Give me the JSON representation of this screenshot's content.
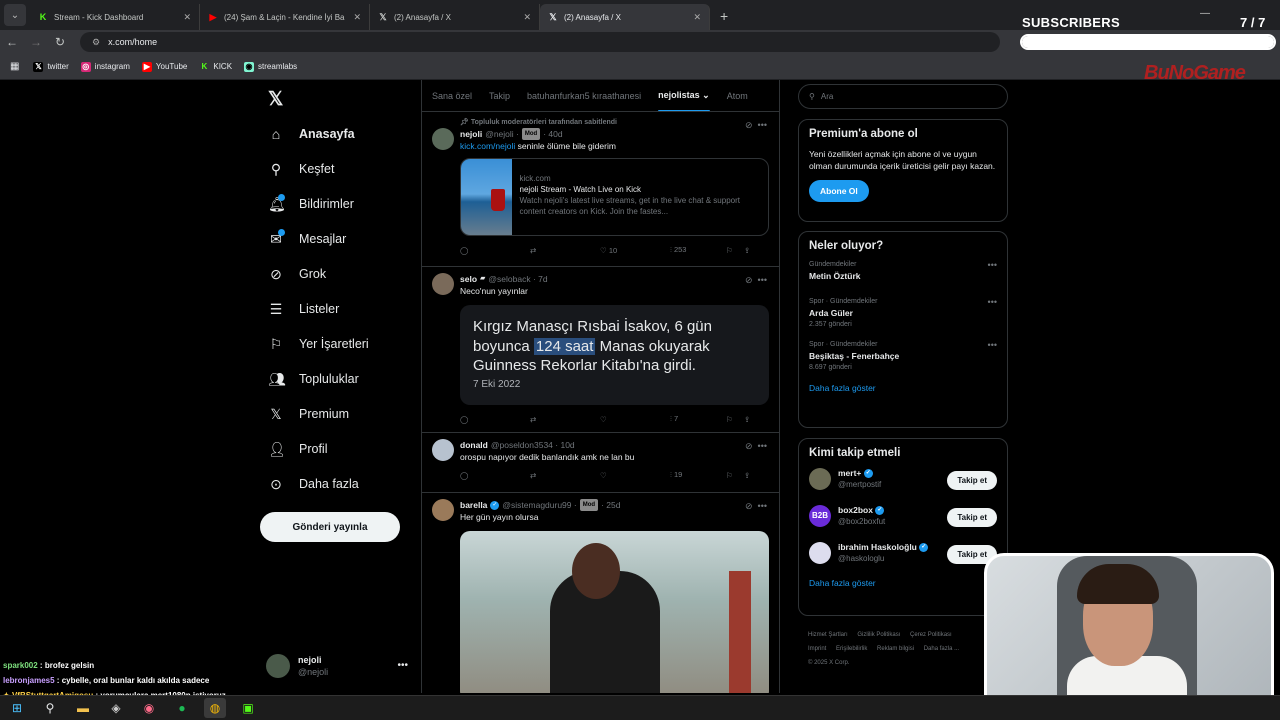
{
  "browser": {
    "tabs": [
      {
        "title": "Stream - Kick Dashboard",
        "icon": "kick-icon"
      },
      {
        "title": "(24) Şam & Laçin - Kendine İyi Ba",
        "icon": "youtube-icon"
      },
      {
        "title": "(2) Anasayfa / X",
        "icon": "x-icon"
      },
      {
        "title": "(2) Anasayfa / X",
        "icon": "x-icon"
      }
    ],
    "url": "x.com/home",
    "bookmarks": [
      "twitter",
      "instagram",
      "YouTube",
      "KICK",
      "streamlabs"
    ]
  },
  "overlay": {
    "subscribers_label": "SUBSCRIBERS",
    "subscribers_count": "7 / 7",
    "subscribers_progress": 1.0,
    "brand": "BuNoGame"
  },
  "sidebar": {
    "items": [
      {
        "label": "Anasayfa",
        "icon": "home-icon"
      },
      {
        "label": "Keşfet",
        "icon": "search-icon"
      },
      {
        "label": "Bildirimler",
        "icon": "bell-icon"
      },
      {
        "label": "Mesajlar",
        "icon": "mail-icon"
      },
      {
        "label": "Grok",
        "icon": "grok-icon"
      },
      {
        "label": "Listeler",
        "icon": "list-icon"
      },
      {
        "label": "Yer İşaretleri",
        "icon": "bookmark-icon"
      },
      {
        "label": "Topluluklar",
        "icon": "people-icon"
      },
      {
        "label": "Premium",
        "icon": "x-logo-icon"
      },
      {
        "label": "Profil",
        "icon": "person-icon"
      },
      {
        "label": "Daha fazla",
        "icon": "more-circle-icon"
      }
    ],
    "post_button": "Gönderi yayınla",
    "account": {
      "name": "nejoli",
      "handle": "@nejoli"
    }
  },
  "timeline": {
    "tabs": [
      "Sana özel",
      "Takip",
      "batuhanfurkan5 kıraathanesi",
      "nejolistas",
      "Atom"
    ],
    "active_tab": "nejolistas",
    "posts": [
      {
        "pinned_note": "Topluluk moderatörleri tarafından sabitlendi",
        "name": "nejoli",
        "handle": "@nejoli",
        "badge": "Mod",
        "time": "40d",
        "link": "kick.com/nejoli",
        "text": " seninle ölüme bile giderim",
        "card": {
          "domain": "kick.com",
          "title": "nejoli Stream - Watch Live on Kick",
          "desc": "Watch nejoli's latest live streams, get in the live chat & support content creators on Kick. Join the fastes..."
        },
        "replies": "",
        "retweets": "",
        "likes": "10",
        "views": "253"
      },
      {
        "name": "selo",
        "handle": "@seloback",
        "time": "7d",
        "text": "Neco'nun yayınlar",
        "quote_before": "Kırgız Manasçı Rısbai İsakov, 6 gün boyunca ",
        "quote_highlight": "124 saat",
        "quote_after": " Manas okuyarak Guinness Rekorlar Kitabı'na girdi.",
        "quote_date": "7 Eki 2022",
        "views": "7"
      },
      {
        "name": "donald",
        "handle": "@poseldon3534",
        "time": "10d",
        "text": "orospu napıyor dedik banlandık amk ne lan bu",
        "views": "19"
      },
      {
        "name": "barella",
        "handle": "@sistemagduru99",
        "badge": "Mod",
        "time": "25d",
        "text": "Her gün yayın olursa"
      }
    ]
  },
  "right": {
    "search_placeholder": "Ara",
    "premium": {
      "title": "Premium'a abone ol",
      "text": "Yeni özellikleri açmak için abone ol ve uygun olman durumunda içerik üreticisi gelir payı kazan.",
      "button": "Abone Ol"
    },
    "trends": {
      "title": "Neler oluyor?",
      "items": [
        {
          "category": "Gündemdekiler",
          "name": "Metin Öztürk",
          "count": ""
        },
        {
          "category": "Spor · Gündemdekiler",
          "name": "Arda Güler",
          "count": "2.357 gönderi"
        },
        {
          "category": "Spor · Gündemdekiler",
          "name": "Beşiktaş - Fenerbahçe",
          "count": "8.697 gönderi"
        }
      ],
      "more": "Daha fazla göster"
    },
    "who_to_follow": {
      "title": "Kimi takip etmeli",
      "items": [
        {
          "name": "mert+",
          "handle": "@mertpostif"
        },
        {
          "name": "box2box",
          "handle": "@box2boxfut"
        },
        {
          "name": "ibrahim Haskoloğlu",
          "handle": "@haskologlu"
        }
      ],
      "follow_label": "Takip et",
      "more": "Daha fazla göster"
    },
    "footer": [
      "Hizmet Şartları",
      "Gizlilik Politikası",
      "Çerez Politikası",
      "Imprint",
      "Erişilebilirlik",
      "Reklam bilgisi",
      "Daha fazla ...",
      "© 2025 X Corp."
    ]
  },
  "chat": [
    {
      "user": "spark002",
      "msg": " : brofez gelsin"
    },
    {
      "user": "lebronjames5",
      "msg": " : cybelle, oral bunlar kaldı akılda sadece"
    },
    {
      "user": "VfBStuttgartAmigosu",
      "msg": " : yorumculara mert1080p istiyoruz"
    }
  ]
}
